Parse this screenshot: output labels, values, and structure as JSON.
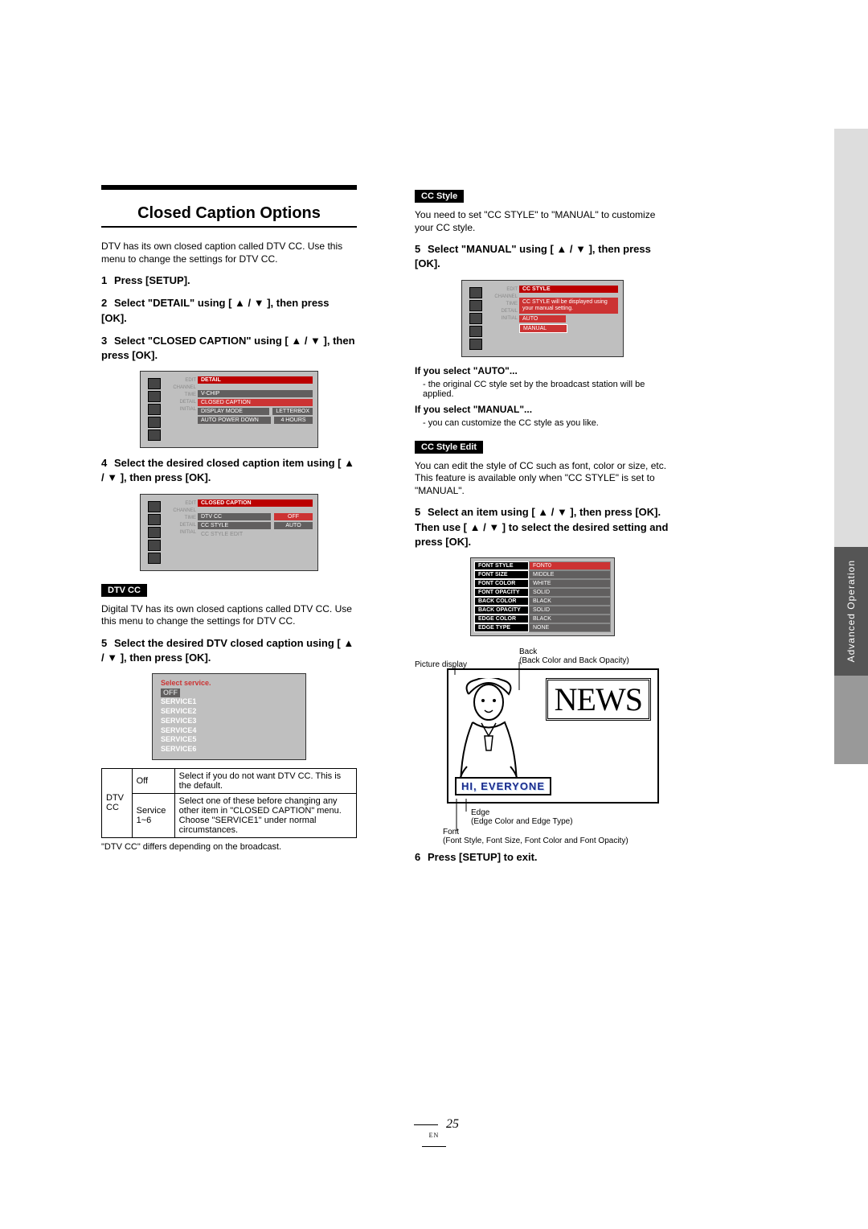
{
  "side_tab_text": "Advanced Operation",
  "title": "Closed Caption Options",
  "intro": "DTV has its own closed caption called DTV CC. Use this menu to change the settings for DTV CC.",
  "steps_left": {
    "s1": "Press [SETUP].",
    "s2": "Select \"DETAIL\" using [ ▲ / ▼ ], then press [OK].",
    "s3": "Select \"CLOSED CAPTION\" using [ ▲ / ▼ ], then press [OK].",
    "s4": "Select the desired closed caption item using [ ▲ / ▼ ], then press [OK].",
    "s5": "Select the desired DTV closed caption using [ ▲ / ▼ ], then press [OK]."
  },
  "dtv_cc_label": "DTV CC",
  "dtv_cc_desc": "Digital TV has its own closed captions called DTV CC. Use this menu to change the settings for DTV CC.",
  "osd1": {
    "title": "DETAIL",
    "rows": [
      {
        "label": "V-CHIP"
      },
      {
        "label": "CLOSED CAPTION"
      },
      {
        "label": "DISPLAY MODE",
        "val": "LETTERBOX"
      },
      {
        "label": "AUTO POWER DOWN",
        "val": "4 HOURS"
      }
    ],
    "side": [
      "EDIT",
      "CHANNEL",
      "TIME",
      "DETAIL",
      "INITIAL"
    ]
  },
  "osd2": {
    "title": "CLOSED CAPTION",
    "rows": [
      {
        "label": "DTV CC",
        "val": "OFF",
        "val_red": true
      },
      {
        "label": "CC STYLE",
        "val": "AUTO"
      },
      {
        "label": "CC STYLE EDIT",
        "dim": true
      }
    ],
    "side": [
      "EDIT",
      "CHANNEL",
      "TIME",
      "DETAIL",
      "INITIAL"
    ]
  },
  "service": {
    "header": "Select service.",
    "off": "OFF",
    "items": [
      "SERVICE1",
      "SERVICE2",
      "SERVICE3",
      "SERVICE4",
      "SERVICE5",
      "SERVICE6"
    ]
  },
  "table": {
    "left": "DTV CC",
    "rows": [
      {
        "k": "Off",
        "v": "Select if you do not want DTV CC. This is the default."
      },
      {
        "k": "Service 1~6",
        "v": "Select one of these before changing any other item in \"CLOSED CAPTION\" menu. Choose \"SERVICE1\" under normal circumstances."
      }
    ]
  },
  "table_foot": "\"DTV CC\" differs depending on the broadcast.",
  "cc_style_label": "CC Style",
  "cc_style_desc": "You need to set \"CC STYLE\" to \"MANUAL\" to customize your CC style.",
  "step5r": "Select \"MANUAL\" using [ ▲ / ▼ ], then press [OK].",
  "osd3": {
    "title": "CC STYLE",
    "msg": "CC STYLE will be displayed using your manual setting.",
    "opts": [
      "AUTO",
      "MANUAL"
    ],
    "side": [
      "EDIT",
      "CHANNEL",
      "TIME",
      "DETAIL",
      "INITIAL"
    ]
  },
  "auto_hdr": "If you select \"AUTO\"...",
  "auto_txt": "- the original CC style set by the broadcast station will be applied.",
  "manual_hdr": "If you select \"MANUAL\"...",
  "manual_txt": "- you can customize the CC style as you like.",
  "cc_style_edit_label": "CC Style Edit",
  "cc_style_edit_desc": "You can edit the style of CC such as font, color or size, etc. This feature is available only when \"CC STYLE\" is set to \"MANUAL\".",
  "step5r2": "Select an item using [ ▲ / ▼ ], then press [OK]. Then use [ ▲ / ▼ ] to select the desired setting and press [OK].",
  "edit_menu": [
    {
      "k": "FONT STYLE",
      "v": "FONT0",
      "hl": true
    },
    {
      "k": "FONT SIZE",
      "v": "MIDDLE"
    },
    {
      "k": "FONT COLOR",
      "v": "WHITE"
    },
    {
      "k": "FONT OPACITY",
      "v": "SOLID"
    },
    {
      "k": "BACK COLOR",
      "v": "BLACK"
    },
    {
      "k": "BACK OPACITY",
      "v": "SOLID"
    },
    {
      "k": "EDGE COLOR",
      "v": "BLACK"
    },
    {
      "k": "EDGE TYPE",
      "v": "NONE"
    }
  ],
  "illus": {
    "pic_display": "Picture display",
    "back": "Back",
    "back_sub": "(Back Color and Back Opacity)",
    "news": "NEWS",
    "caption": "HI, EVERYONE",
    "edge": "Edge",
    "edge_sub": "(Edge Color and Edge Type)",
    "font": "Font",
    "font_sub": "(Font Style, Font Size, Font Color and Font Opacity)"
  },
  "step6": "Press [SETUP] to exit.",
  "page_num": "25",
  "page_lang": "EN"
}
